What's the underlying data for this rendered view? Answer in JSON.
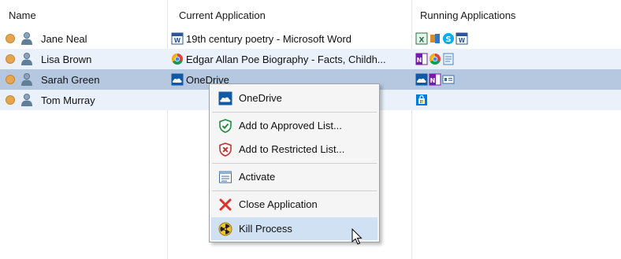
{
  "columns": {
    "name": "Name",
    "current_app": "Current Application",
    "running_apps": "Running Applications"
  },
  "rows": [
    {
      "name": "Jane Neal",
      "current_app": "19th century poetry - Microsoft Word",
      "current_app_icon": "word-icon",
      "running_icons": [
        "excel-icon",
        "lync-icon",
        "skype-icon",
        "word-icon"
      ]
    },
    {
      "name": "Lisa Brown",
      "current_app": "Edgar Allan Poe Biography - Facts, Childh...",
      "current_app_icon": "chrome-icon",
      "running_icons": [
        "onenote-icon",
        "chrome-icon",
        "notepad-icon"
      ]
    },
    {
      "name": "Sarah Green",
      "current_app": "OneDrive",
      "current_app_icon": "onedrive-icon",
      "running_icons": [
        "onedrive-icon",
        "onenote-icon",
        "window-icon"
      ]
    },
    {
      "name": "Tom Murray",
      "current_app": "",
      "current_app_icon": "",
      "running_icons": [
        "store-icon"
      ]
    }
  ],
  "context_menu": {
    "items": [
      {
        "label": "OneDrive",
        "icon": "onedrive-icon"
      },
      {
        "label": "Add to Approved List...",
        "icon": "shield-check-icon"
      },
      {
        "label": "Add to Restricted List...",
        "icon": "shield-x-icon"
      },
      {
        "label": "Activate",
        "icon": "activate-window-icon"
      },
      {
        "label": "Close Application",
        "icon": "close-x-icon"
      },
      {
        "label": "Kill Process",
        "icon": "radiation-icon"
      }
    ]
  },
  "colors": {
    "selected_row": "#b5c8e0",
    "alt_row": "#eaf1fb",
    "menu_highlight": "#cfe1f3",
    "status_dot": "#e5a64f"
  }
}
